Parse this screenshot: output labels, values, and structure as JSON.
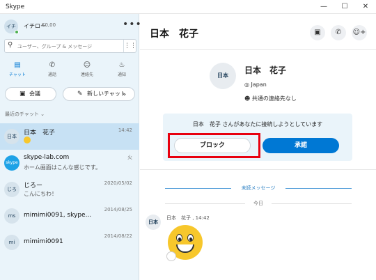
{
  "window": {
    "title": "Skype",
    "minimize_icon": "minimize-icon",
    "maximize_icon": "maximize-icon",
    "close_icon": "close-icon"
  },
  "profile": {
    "avatar_text": "イチ",
    "name": "イチロー",
    "credit": "€0,00",
    "more_label": "•••"
  },
  "search": {
    "placeholder": "ユーザー、グループ & メッセージ"
  },
  "nav": [
    {
      "label": "チャット",
      "icon": "chat-icon",
      "active": true
    },
    {
      "label": "通話",
      "icon": "phone-icon",
      "active": false
    },
    {
      "label": "連絡先",
      "icon": "contacts-icon",
      "active": false
    },
    {
      "label": "通知",
      "icon": "bell-icon",
      "active": false
    }
  ],
  "actions": {
    "meeting_label": "会議",
    "new_chat_label": "新しいチャット"
  },
  "recent_header": "最近のチャット",
  "chats": [
    {
      "avatar": "日本",
      "name": "日本　花子",
      "preview": "",
      "time": "14:42",
      "active": true
    },
    {
      "avatar": "skype",
      "name": "skype-lab.com",
      "preview": "ホーム画面はこんな感じです。",
      "time": "火",
      "active": false
    },
    {
      "avatar": "じろ",
      "name": "じろー",
      "preview": "こんにちわ！",
      "time": "2020/05/02",
      "active": false
    },
    {
      "avatar": "ms",
      "name": "mimimi0091, skype...",
      "preview": "",
      "time": "2014/08/25",
      "active": false
    },
    {
      "avatar": "mi",
      "name": "mimimi0091",
      "preview": "",
      "time": "2014/08/22",
      "active": false
    }
  ],
  "conversation": {
    "title": "日本　花子",
    "header_icons": [
      "video-call-icon",
      "phone-icon",
      "add-person-icon"
    ],
    "contact": {
      "avatar": "日本",
      "name": "日本　花子",
      "location": "Japan",
      "common": "共通の連絡先なし"
    },
    "request": {
      "text": "日本　花子 さんがあなたに接続しようとしています",
      "block_label": "ブロック",
      "accept_label": "承諾"
    },
    "unread_label": "未読メッセージ",
    "today_label": "今日",
    "message": {
      "avatar": "日本",
      "meta": "日本　花子 , 14:42"
    }
  }
}
